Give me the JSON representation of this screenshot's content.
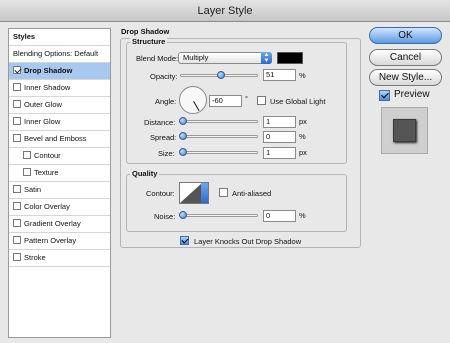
{
  "window": {
    "title": "Layer Style"
  },
  "left_panel": {
    "header": "Styles",
    "items": [
      {
        "label": "Blending Options: Default",
        "checkbox": false,
        "checked": false,
        "indent": false,
        "selected": false
      },
      {
        "label": "Drop Shadow",
        "checkbox": true,
        "checked": true,
        "indent": false,
        "selected": true
      },
      {
        "label": "Inner Shadow",
        "checkbox": true,
        "checked": false,
        "indent": false,
        "selected": false
      },
      {
        "label": "Outer Glow",
        "checkbox": true,
        "checked": false,
        "indent": false,
        "selected": false
      },
      {
        "label": "Inner Glow",
        "checkbox": true,
        "checked": false,
        "indent": false,
        "selected": false
      },
      {
        "label": "Bevel and Emboss",
        "checkbox": true,
        "checked": false,
        "indent": false,
        "selected": false
      },
      {
        "label": "Contour",
        "checkbox": true,
        "checked": false,
        "indent": true,
        "selected": false
      },
      {
        "label": "Texture",
        "checkbox": true,
        "checked": false,
        "indent": true,
        "selected": false
      },
      {
        "label": "Satin",
        "checkbox": true,
        "checked": false,
        "indent": false,
        "selected": false
      },
      {
        "label": "Color Overlay",
        "checkbox": true,
        "checked": false,
        "indent": false,
        "selected": false
      },
      {
        "label": "Gradient Overlay",
        "checkbox": true,
        "checked": false,
        "indent": false,
        "selected": false
      },
      {
        "label": "Pattern Overlay",
        "checkbox": true,
        "checked": false,
        "indent": false,
        "selected": false
      },
      {
        "label": "Stroke",
        "checkbox": true,
        "checked": false,
        "indent": false,
        "selected": false
      }
    ]
  },
  "panel": {
    "title": "Drop Shadow",
    "structure": {
      "title": "Structure",
      "blend_mode_label": "Blend Mode:",
      "blend_mode_value": "Multiply",
      "shadow_color": "#000000",
      "opacity_label": "Opacity:",
      "opacity_value": "51",
      "opacity_unit": "%",
      "opacity_fraction": 0.51,
      "angle_label": "Angle:",
      "angle_value": "-60",
      "angle_unit": "°",
      "use_global_light_label": "Use Global Light",
      "use_global_light_checked": false,
      "distance_label": "Distance:",
      "distance_value": "1",
      "distance_unit": "px",
      "spread_label": "Spread:",
      "spread_value": "0",
      "spread_unit": "%",
      "size_label": "Size:",
      "size_value": "1",
      "size_unit": "px"
    },
    "quality": {
      "title": "Quality",
      "contour_label": "Contour:",
      "anti_aliased_label": "Anti-aliased",
      "anti_aliased_checked": false,
      "noise_label": "Noise:",
      "noise_value": "0",
      "noise_unit": "%"
    },
    "knockout_label": "Layer Knocks Out Drop Shadow",
    "knockout_checked": true
  },
  "buttons": {
    "ok": "OK",
    "cancel": "Cancel",
    "new_style": "New Style...",
    "preview_label": "Preview",
    "preview_checked": true
  },
  "colors": {
    "accent": "#5e9ae0",
    "selection": "#a8c9ef"
  }
}
